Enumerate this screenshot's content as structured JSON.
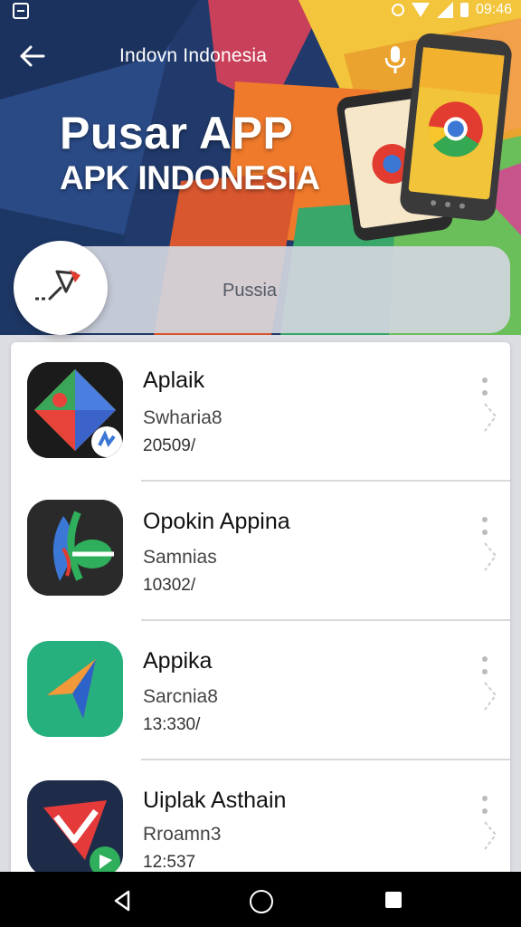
{
  "status_bar": {
    "time": "09:46"
  },
  "app_bar": {
    "title": "Indovn Indonesia"
  },
  "hero": {
    "line1": "Pusar APP",
    "line2": "APK INDONESIA"
  },
  "search": {
    "placeholder": "Pussia"
  },
  "apps": [
    {
      "name": "Aplaik",
      "publisher": "Swharia8",
      "version": "20509/",
      "icon": "multicolor-diamond-icon"
    },
    {
      "name": "Opokin Appina",
      "publisher": "Samnias",
      "version": "10302/",
      "icon": "leaf-swirl-icon"
    },
    {
      "name": "Appika",
      "publisher": "Sarcnia8",
      "version": "13:330/",
      "icon": "orange-arrow-icon"
    },
    {
      "name": "Uiplak Asthain",
      "publisher": "Rroamn3",
      "version": "12:537",
      "icon": "red-check-icon"
    }
  ],
  "colors": {
    "hero_bg": "#213a6b",
    "accent_orange": "#f0792a",
    "accent_yellow": "#f4c63d",
    "accent_green": "#2fae5b"
  }
}
